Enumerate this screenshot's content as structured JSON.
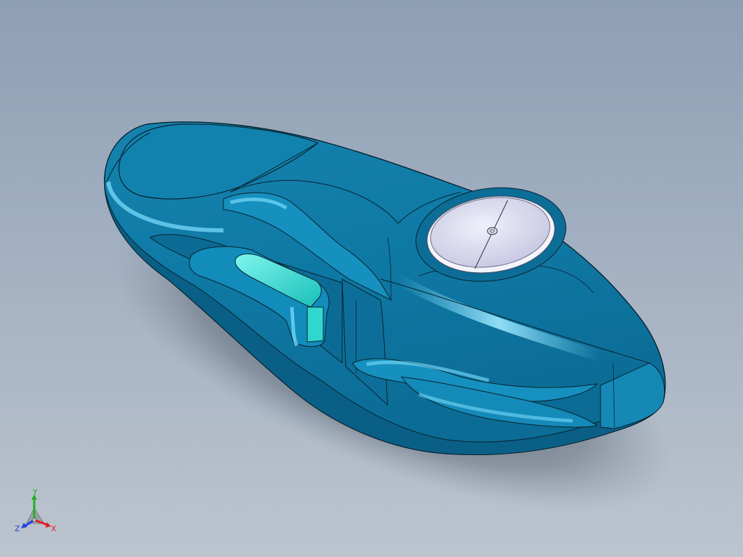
{
  "viewport": {
    "background_top": "#8e9fb4",
    "background_bottom": "#bcc4ce"
  },
  "model": {
    "body_color": "#1f8fb8",
    "highlight_color": "#5cc8ec",
    "edge_color": "#0a1a24",
    "cap_color": "#dcdcf0",
    "window_color": "#33e0d8"
  },
  "triad": {
    "x_label": "X",
    "y_label": "Y",
    "z_label": "Z",
    "x_color": "#e02020",
    "y_color": "#20b020",
    "z_color": "#2040e0"
  }
}
